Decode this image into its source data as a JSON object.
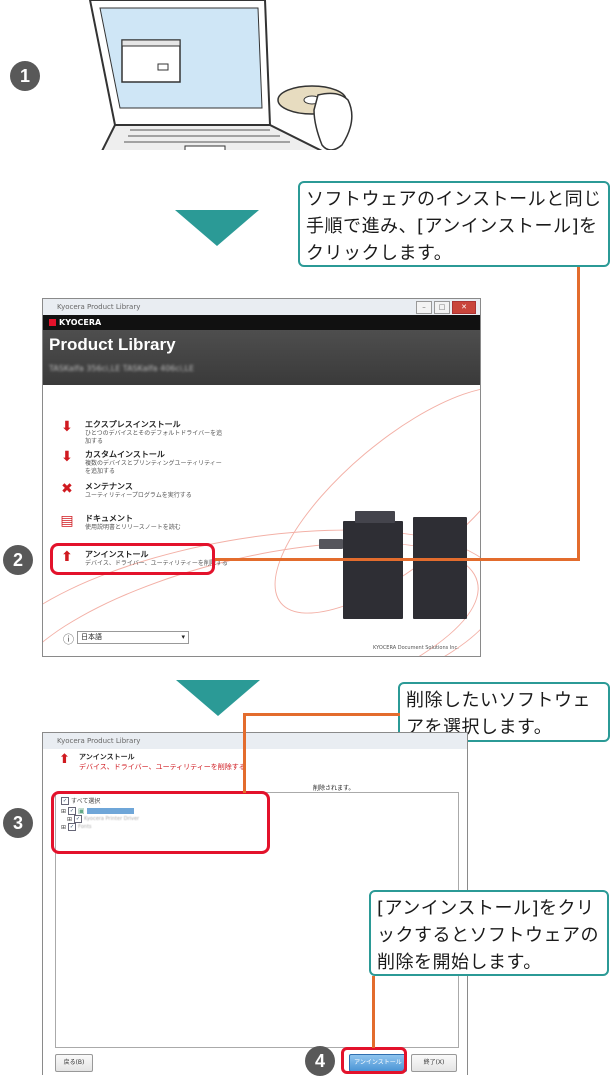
{
  "steps": {
    "s1": "1",
    "s2": "2",
    "s3": "3",
    "s4": "4"
  },
  "callouts": {
    "c1": "ソフトウェアのインストールと同じ手順で進み、[アンインストール]をクリックします。",
    "c2": "削除したいソフトウェアを選択します。",
    "c3": "[アンインストール]をクリックするとソフトウェアの削除を開始します。"
  },
  "window1": {
    "title": "Kyocera Product Library",
    "brand": "KYOCERA",
    "product_title": "Product Library",
    "product_models": "TASKalfa 356ci,LE TASKalfa 406ci,LE",
    "menu": [
      {
        "icon": "⬇",
        "title": "エクスプレスインストール",
        "desc": "ひとつのデバイスとそのデフォルトドライバーを追加する"
      },
      {
        "icon": "⬇",
        "title": "カスタムインストール",
        "desc": "複数のデバイスとプリンティングユーティリティーを追加する"
      },
      {
        "icon": "✖",
        "title": "メンテナンス",
        "desc": "ユーティリティープログラムを実行する"
      },
      {
        "icon": "▤",
        "title": "ドキュメント",
        "desc": "使用説明書とリリースノートを読む"
      },
      {
        "icon": "⬆",
        "title": "アンインストール",
        "desc": "デバイス、ドライバー、ユーティリティーを削除する"
      }
    ],
    "language": "日本語",
    "copyright": "KYOCERA Document Solutions Inc."
  },
  "window2": {
    "title": "Kyocera Product Library",
    "heading": "アンインストール",
    "subheading": "デバイス、ドライバー、ユーティリティーを削除する",
    "notice": "削除されます。",
    "select_all": "すべて選択",
    "items": [
      "Kyocera TASKalfa",
      "Kyocera Printer Driver",
      "Fonts"
    ],
    "back_button": "戻る(B)",
    "uninstall_button": "アンインストール(U)",
    "finish_button": "終了(X)"
  }
}
